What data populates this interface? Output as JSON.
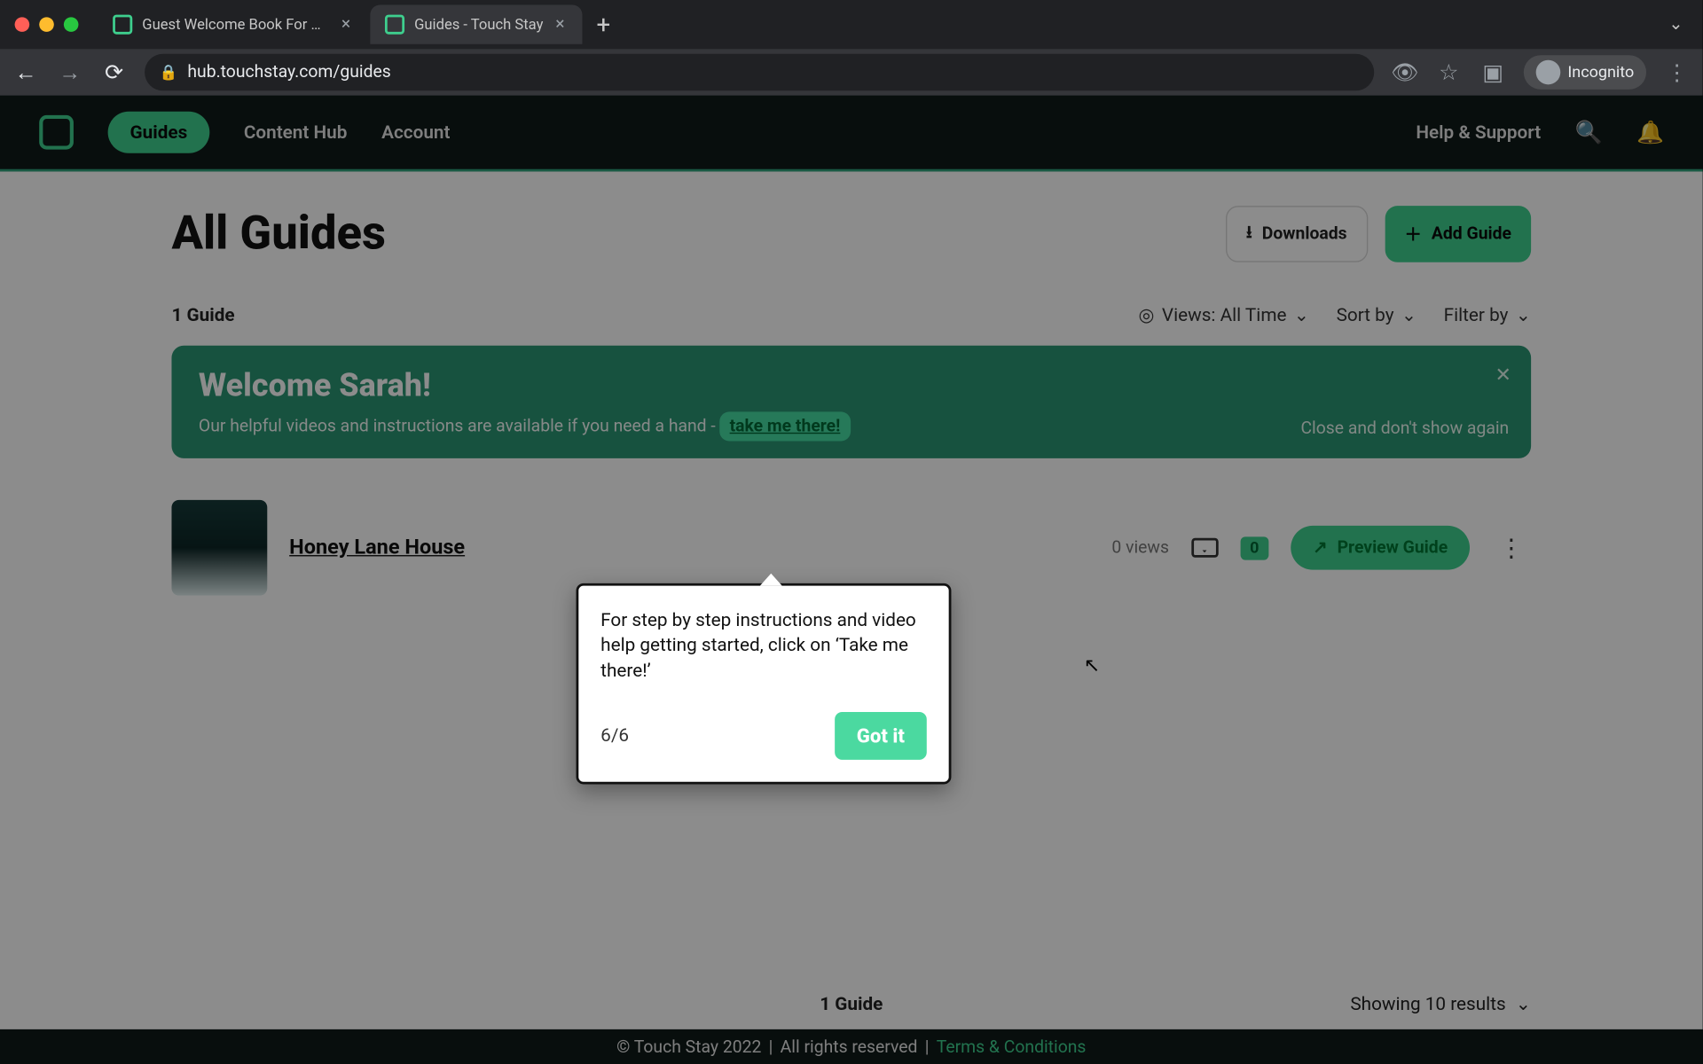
{
  "browser": {
    "tabs": [
      {
        "title": "Guest Welcome Book For Vaca",
        "active": false
      },
      {
        "title": "Guides - Touch Stay",
        "active": true
      }
    ],
    "url": "hub.touchstay.com/guides",
    "incognito_label": "Incognito"
  },
  "header": {
    "nav": {
      "guides": "Guides",
      "content_hub": "Content Hub",
      "account": "Account"
    },
    "help": "Help & Support"
  },
  "page": {
    "title": "All Guides",
    "downloads": "Downloads",
    "add_guide": "Add Guide",
    "guide_count": "1 Guide",
    "views_filter": "Views: All Time",
    "sort_by": "Sort by",
    "filter_by": "Filter by"
  },
  "banner": {
    "title": "Welcome Sarah!",
    "text_prefix": "Our helpful videos and instructions are available if you need a hand - ",
    "take_me": "take me there!",
    "dont_show": "Close and don't show again"
  },
  "guide_row": {
    "name": "Honey Lane House",
    "views": "0 views",
    "mail_count": "0",
    "preview": "Preview Guide"
  },
  "pager": {
    "count": "1 Guide",
    "showing": "Showing 10 results"
  },
  "footer": {
    "copyright": "© Touch Stay 2022",
    "sep": " | ",
    "rights": "All rights reserved",
    "terms": "Terms & Conditions"
  },
  "popover": {
    "text": "For step by step instructions and video help getting started, click on ‘Take me there!’",
    "step": "6/6",
    "got_it": "Got it"
  }
}
